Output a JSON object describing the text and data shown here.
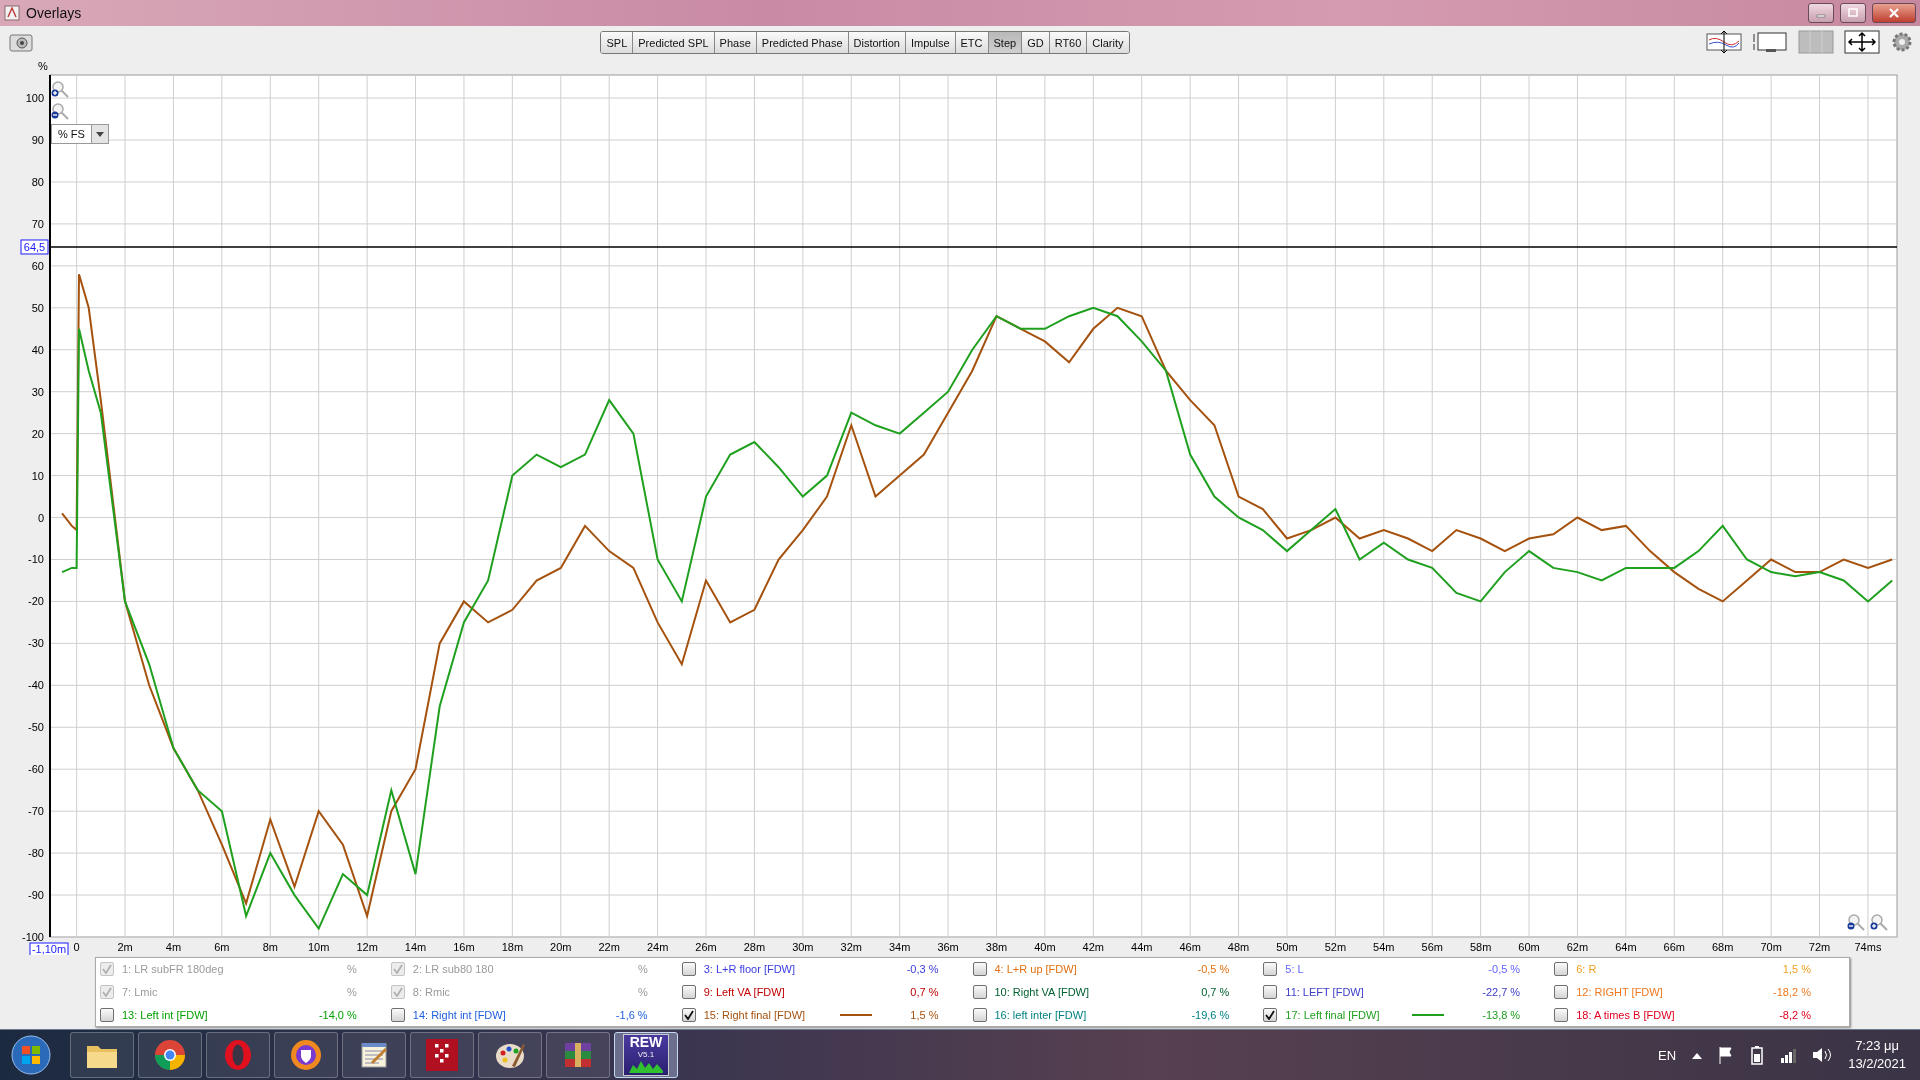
{
  "window": {
    "title": "Overlays"
  },
  "toolbar": {
    "tabs": [
      {
        "label": "SPL",
        "selected": false
      },
      {
        "label": "Predicted SPL",
        "selected": false
      },
      {
        "label": "Phase",
        "selected": false
      },
      {
        "label": "Predicted Phase",
        "selected": false
      },
      {
        "label": "Distortion",
        "selected": false
      },
      {
        "label": "Impulse",
        "selected": false
      },
      {
        "label": "ETC",
        "selected": false
      },
      {
        "label": "Step",
        "selected": true
      },
      {
        "label": "GD",
        "selected": false
      },
      {
        "label": "RT60",
        "selected": false
      },
      {
        "label": "Clarity",
        "selected": false
      }
    ]
  },
  "graph": {
    "unit_selector": "% FS",
    "chart_data": {
      "type": "line",
      "ylabel": "%",
      "x": [
        -0.6,
        -0.2,
        0,
        0.1,
        0.5,
        1,
        2,
        3,
        4,
        5,
        6,
        7,
        8,
        9,
        10,
        11,
        12,
        13,
        14,
        15,
        16,
        17,
        18,
        19,
        20,
        21,
        22,
        23,
        24,
        25,
        26,
        27,
        28,
        29,
        30,
        31,
        32,
        33,
        34,
        35,
        36,
        37,
        38,
        39,
        40,
        41,
        42,
        43,
        44,
        45,
        46,
        47,
        48,
        49,
        50,
        51,
        52,
        53,
        54,
        55,
        56,
        57,
        58,
        59,
        60,
        61,
        62,
        63,
        64,
        65,
        66,
        67,
        68,
        69,
        70,
        71,
        72,
        73,
        74,
        75
      ],
      "series": [
        {
          "color": "#a5520f",
          "values": [
            1,
            -2,
            -3,
            58,
            50,
            28,
            -20,
            -40,
            -55,
            -65,
            -78,
            -92,
            -72,
            -88,
            -70,
            -78,
            -95,
            -70,
            -60,
            -30,
            -20,
            -25,
            -22,
            -15,
            -12,
            -2,
            -8,
            -12,
            -25,
            -35,
            -15,
            -25,
            -22,
            -10,
            -3,
            5,
            22,
            5,
            10,
            15,
            25,
            35,
            48,
            45,
            42,
            37,
            45,
            50,
            48,
            35,
            28,
            22,
            5,
            2,
            -5,
            -3,
            0,
            -5,
            -3,
            -5,
            -8,
            -3,
            -5,
            -8,
            -5,
            -4,
            0,
            -3,
            -2,
            -8,
            -13,
            -17,
            -20,
            -15,
            -10,
            -13,
            -13,
            -10,
            -12,
            -10
          ]
        },
        {
          "color": "#1fa01f",
          "values": [
            -13,
            -12,
            -12,
            45,
            35,
            25,
            -20,
            -35,
            -55,
            -65,
            -70,
            -95,
            -80,
            -90,
            -98,
            -85,
            -90,
            -65,
            -85,
            -45,
            -25,
            -15,
            10,
            15,
            12,
            15,
            28,
            20,
            -10,
            -20,
            5,
            15,
            18,
            12,
            5,
            10,
            25,
            22,
            20,
            25,
            30,
            40,
            48,
            45,
            45,
            48,
            50,
            48,
            42,
            35,
            15,
            5,
            0,
            -3,
            -8,
            -3,
            2,
            -10,
            -6,
            -10,
            -12,
            -18,
            -20,
            -13,
            -8,
            -12,
            -13,
            -15,
            -12,
            -12,
            -12,
            -8,
            -2,
            -10,
            -13,
            -14,
            -13,
            -15,
            -20,
            -15
          ]
        }
      ],
      "xlim": [
        -1.1,
        75.2
      ],
      "ylim": [
        -100,
        105.5
      ],
      "xticks": [
        {
          "value": 0,
          "label": "0"
        },
        {
          "value": 2,
          "label": "2m"
        },
        {
          "value": 4,
          "label": "4m"
        },
        {
          "value": 6,
          "label": "6m"
        },
        {
          "value": 8,
          "label": "8m"
        },
        {
          "value": 10,
          "label": "10m"
        },
        {
          "value": 12,
          "label": "12m"
        },
        {
          "value": 14,
          "label": "14m"
        },
        {
          "value": 16,
          "label": "16m"
        },
        {
          "value": 18,
          "label": "18m"
        },
        {
          "value": 20,
          "label": "20m"
        },
        {
          "value": 22,
          "label": "22m"
        },
        {
          "value": 24,
          "label": "24m"
        },
        {
          "value": 26,
          "label": "26m"
        },
        {
          "value": 28,
          "label": "28m"
        },
        {
          "value": 30,
          "label": "30m"
        },
        {
          "value": 32,
          "label": "32m"
        },
        {
          "value": 34,
          "label": "34m"
        },
        {
          "value": 36,
          "label": "36m"
        },
        {
          "value": 38,
          "label": "38m"
        },
        {
          "value": 40,
          "label": "40m"
        },
        {
          "value": 42,
          "label": "42m"
        },
        {
          "value": 44,
          "label": "44m"
        },
        {
          "value": 46,
          "label": "46m"
        },
        {
          "value": 48,
          "label": "48m"
        },
        {
          "value": 50,
          "label": "50m"
        },
        {
          "value": 52,
          "label": "52m"
        },
        {
          "value": 54,
          "label": "54m"
        },
        {
          "value": 56,
          "label": "56m"
        },
        {
          "value": 58,
          "label": "58m"
        },
        {
          "value": 60,
          "label": "60m"
        },
        {
          "value": 62,
          "label": "62m"
        },
        {
          "value": 64,
          "label": "64m"
        },
        {
          "value": 66,
          "label": "66m"
        },
        {
          "value": 68,
          "label": "68m"
        },
        {
          "value": 70,
          "label": "70m"
        },
        {
          "value": 72,
          "label": "72m"
        },
        {
          "value": 74,
          "label": "74ms"
        }
      ],
      "yticks": [
        100,
        90,
        80,
        70,
        60,
        50,
        40,
        30,
        20,
        10,
        0,
        -10,
        -20,
        -30,
        -40,
        -50,
        -60,
        -70,
        -80,
        -90,
        -100
      ],
      "grid": true,
      "ref_lines": [
        {
          "axis": "y",
          "value": 64.5,
          "label": "64,5"
        }
      ]
    },
    "cursor_time": "-1,10m"
  },
  "legend": [
    {
      "label": "1: LR subFR 180deg",
      "value": "%",
      "checked": true,
      "disabled": true,
      "color": "#9a9a9a"
    },
    {
      "label": "2: LR sub80 180",
      "value": "%",
      "checked": true,
      "disabled": true,
      "color": "#9a9a9a"
    },
    {
      "label": "3: L+R floor [FDW]",
      "value": "-0,3 %",
      "checked": false,
      "disabled": false,
      "color": "#3c3ce0"
    },
    {
      "label": "4: L+R up [FDW]",
      "value": "-0,5 %",
      "checked": false,
      "disabled": false,
      "color": "#e07010"
    },
    {
      "label": "5: L",
      "value": "-0,5 %",
      "checked": false,
      "disabled": false,
      "color": "#6464ff"
    },
    {
      "label": "6: R",
      "value": "1,5 %",
      "checked": false,
      "disabled": false,
      "color": "#f0a020"
    },
    {
      "label": "7: Lmic",
      "value": "%",
      "checked": true,
      "disabled": true,
      "color": "#9a9a9a"
    },
    {
      "label": "8: Rmic",
      "value": "%",
      "checked": true,
      "disabled": true,
      "color": "#9a9a9a"
    },
    {
      "label": "9: Left VA [FDW]",
      "value": "0,7 %",
      "checked": false,
      "disabled": false,
      "color": "#c00000"
    },
    {
      "label": "10: Right VA [FDW]",
      "value": "0,7 %",
      "checked": false,
      "disabled": false,
      "color": "#006030"
    },
    {
      "label": "11: LEFT [FDW]",
      "value": "-22,7 %",
      "checked": false,
      "disabled": false,
      "color": "#4040c8"
    },
    {
      "label": "12: RIGHT [FDW]",
      "value": "-18,2 %",
      "checked": false,
      "disabled": false,
      "color": "#f07820"
    },
    {
      "label": "13: Left int [FDW]",
      "value": "-14,0 %",
      "checked": false,
      "disabled": false,
      "color": "#00a000"
    },
    {
      "label": "14: Right int [FDW]",
      "value": "-1,6 %",
      "checked": false,
      "disabled": false,
      "color": "#2060e0"
    },
    {
      "label": "15: Right final [FDW]",
      "value": "1,5 %",
      "checked": true,
      "disabled": false,
      "color": "#a5520f"
    },
    {
      "label": "16: left inter [FDW]",
      "value": "-19,6 %",
      "checked": false,
      "disabled": false,
      "color": "#008080"
    },
    {
      "label": "17: Left final [FDW]",
      "value": "-13,8 %",
      "checked": true,
      "disabled": false,
      "color": "#1fa01f"
    },
    {
      "label": "18: A times B [FDW]",
      "value": "-8,2 %",
      "checked": false,
      "disabled": false,
      "color": "#e00020"
    }
  ],
  "taskbar": {
    "apps": [
      {
        "kind": "folder",
        "active": false
      },
      {
        "kind": "chrome",
        "active": false
      },
      {
        "kind": "opera",
        "active": false
      },
      {
        "kind": "browser",
        "active": false
      },
      {
        "kind": "notepad",
        "active": false
      },
      {
        "kind": "grid",
        "active": false
      },
      {
        "kind": "paint",
        "active": false
      },
      {
        "kind": "archive",
        "active": false
      },
      {
        "kind": "rew",
        "active": true,
        "label": "REW",
        "sublabel": "V5.1"
      }
    ],
    "language": "EN",
    "time": "7:23 μμ",
    "date": "13/2/2021"
  }
}
